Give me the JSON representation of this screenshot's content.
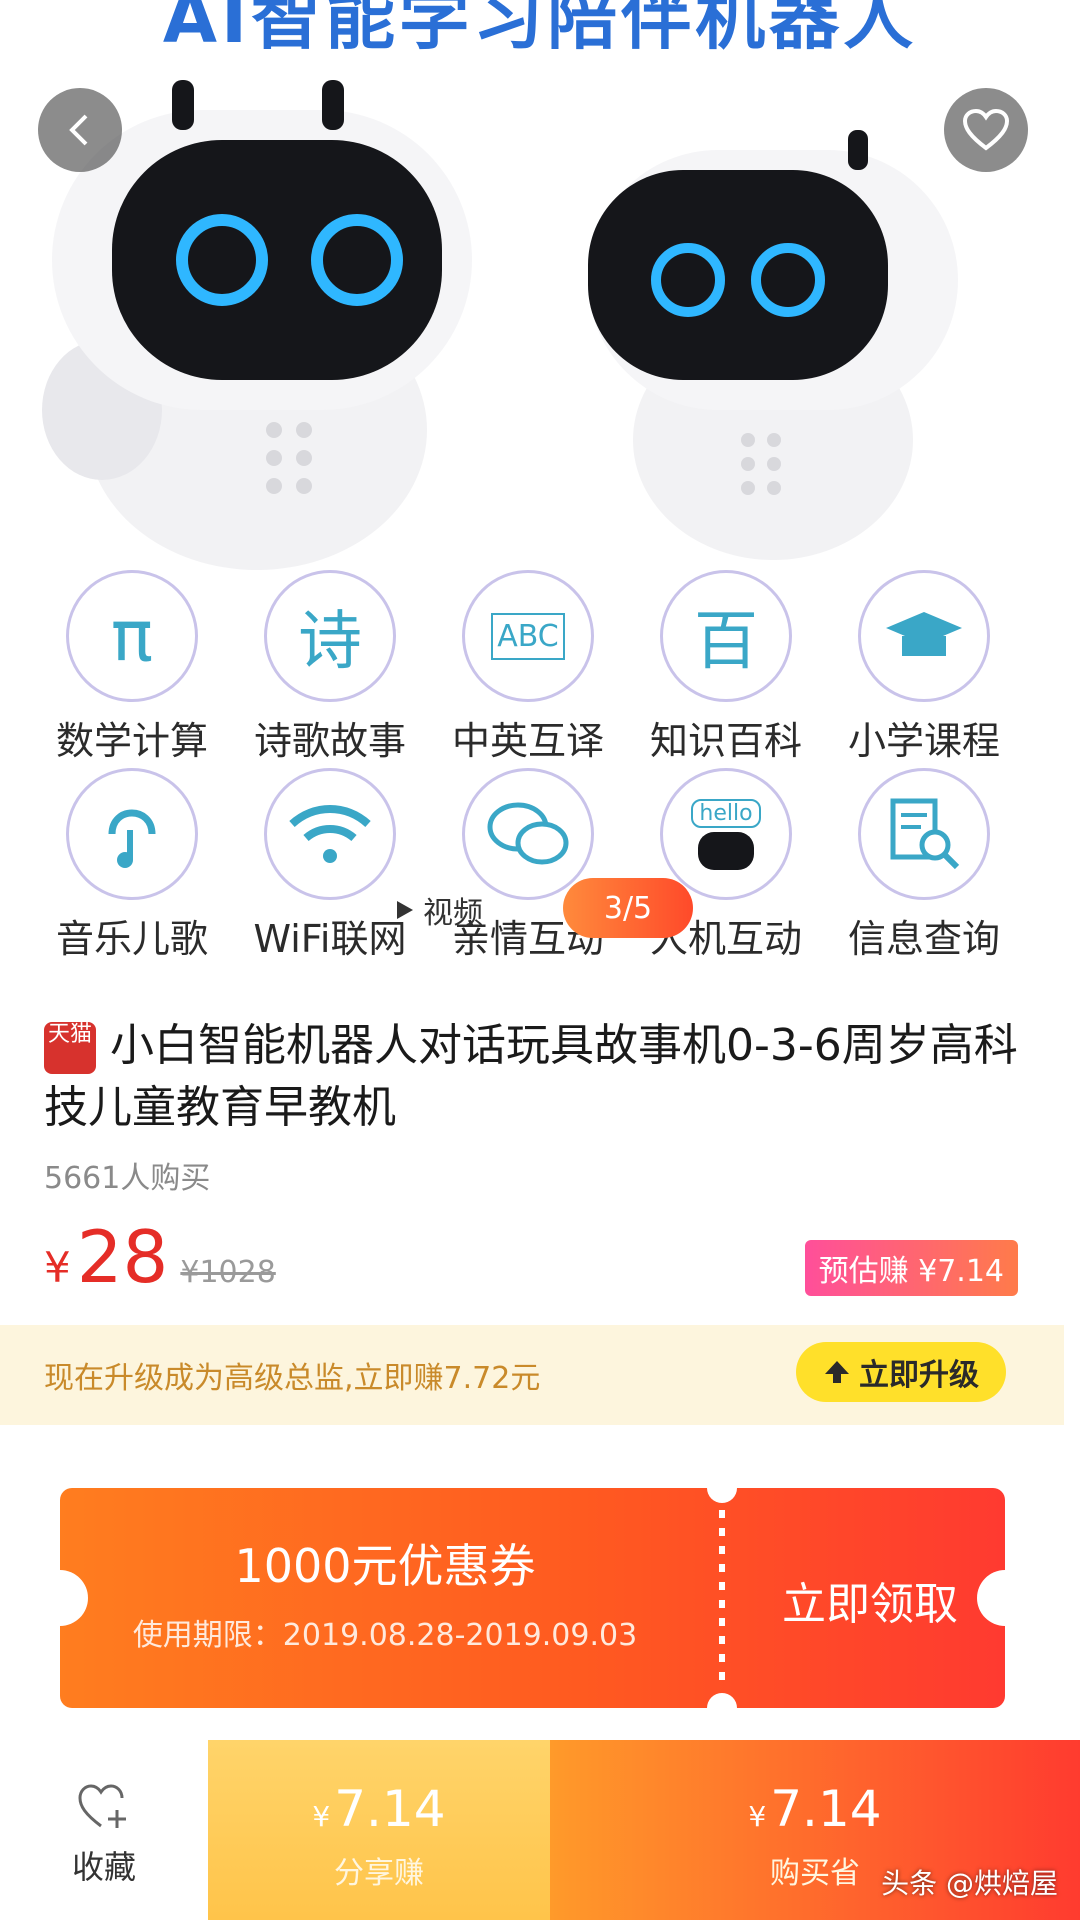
{
  "hero": {
    "banner_text": "AI智能学习陪伴机器人",
    "video_label": "视频",
    "image_counter": "3/5",
    "features": [
      {
        "label": "数学计算",
        "icon": "pi-icon",
        "glyph": "π"
      },
      {
        "label": "诗歌故事",
        "icon": "poem-icon",
        "glyph": "诗"
      },
      {
        "label": "中英互译",
        "icon": "abc-blocks-icon",
        "glyph": "ABC"
      },
      {
        "label": "知识百科",
        "icon": "encyclopedia-icon",
        "glyph": "百"
      },
      {
        "label": "小学课程",
        "icon": "graduation-cap-icon",
        "glyph": ""
      },
      {
        "label": "音乐儿歌",
        "icon": "music-ear-icon",
        "glyph": ""
      },
      {
        "label": "WiFi联网",
        "icon": "wifi-icon",
        "glyph": ""
      },
      {
        "label": "亲情互动",
        "icon": "chat-bubbles-icon",
        "glyph": ""
      },
      {
        "label": "人机互动",
        "icon": "robot-hello-icon",
        "glyph": "hello"
      },
      {
        "label": "信息查询",
        "icon": "document-search-icon",
        "glyph": ""
      }
    ]
  },
  "product": {
    "platform_badge": "天猫",
    "title": "小白智能机器人对话玩具故事机0-3-6周岁高科技儿童教育早教机",
    "sold": "5661人购买",
    "currency": "¥",
    "price": "28",
    "original_price": "¥1028",
    "estimated_earn": "预估赚 ¥7.14"
  },
  "upgrade": {
    "text": "现在升级成为高级总监,立即赚7.72元",
    "button_label": "立即升级"
  },
  "coupon": {
    "amount": "1000元优惠券",
    "period": "使用期限：2019.08.28-2019.09.03",
    "claim_label": "立即领取"
  },
  "bottom_bar": {
    "favorite_label": "收藏",
    "share_amount": "7.14",
    "share_label": "分享赚",
    "buy_amount": "7.14",
    "buy_label": "购买省",
    "currency": "¥"
  },
  "watermark": "头条 @烘焙屋",
  "colors": {
    "price_red": "#e52d27",
    "coupon_orange": "#ff5a20",
    "upgrade_yellow": "#ffe02a",
    "share_yellow": "#ffc44a",
    "buy_red": "#ff3b2f"
  }
}
